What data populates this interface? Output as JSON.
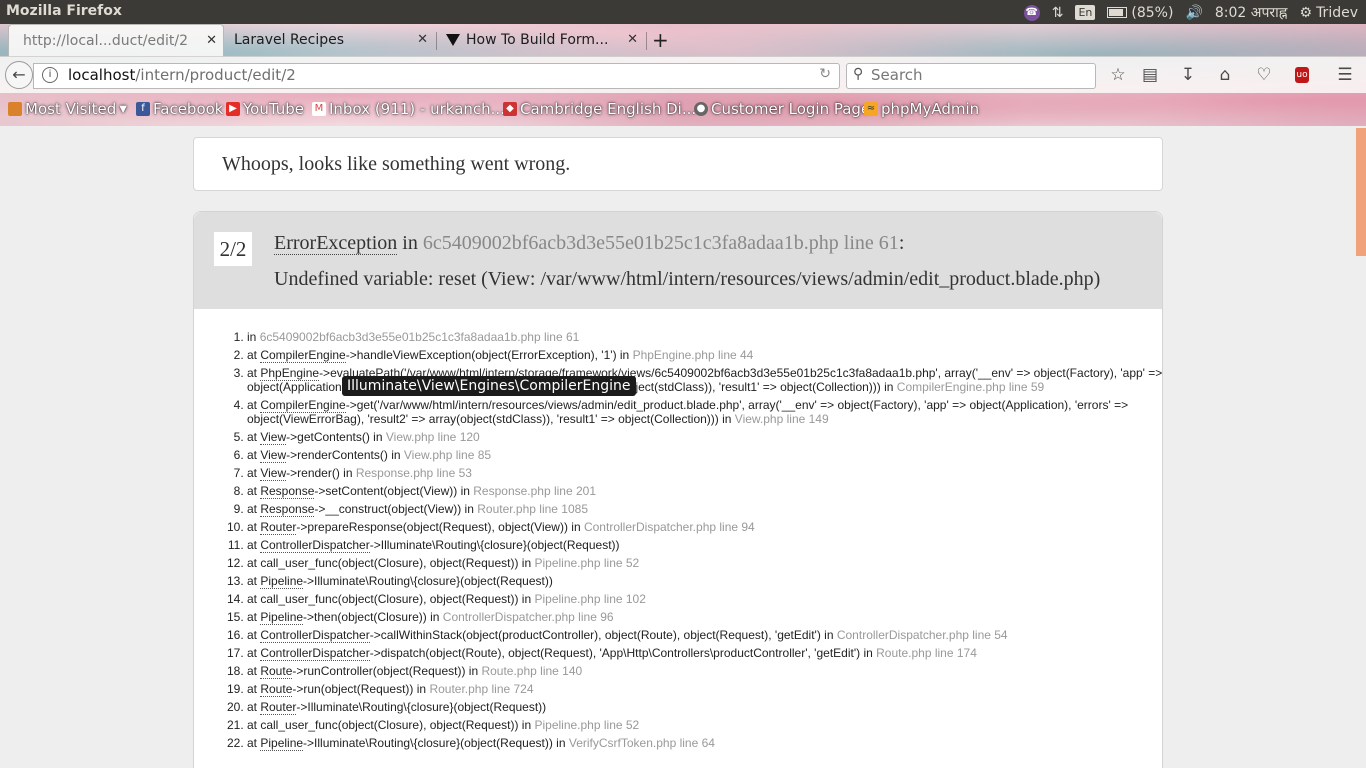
{
  "system": {
    "app_name": "Mozilla Firefox",
    "keyboard": "En",
    "battery": "(85%)",
    "time": "8:02 अपराह्न",
    "user": "Tridev"
  },
  "tabs": [
    {
      "label": "http://local...duct/edit/2"
    },
    {
      "label": "Laravel Recipes"
    },
    {
      "label": "How To Build Form..."
    }
  ],
  "navbar": {
    "url_host": "localhost",
    "url_path": "/intern/product/edit/2",
    "search_placeholder": "Search"
  },
  "bookmarks": [
    {
      "label": "Most Visited"
    },
    {
      "label": "Facebook"
    },
    {
      "label": "YouTube"
    },
    {
      "label": "Inbox (911) - urkanch..."
    },
    {
      "label": "Cambridge English Di..."
    },
    {
      "label": "Customer Login Page"
    },
    {
      "label": "phpMyAdmin"
    }
  ],
  "page": {
    "whoops": "Whoops, looks like something went wrong.",
    "counter": "2/2",
    "exception": "ErrorException",
    "in_word": "in",
    "file_line": "6c5409002bf6acb3d3e55e01b25c1c3fa8adaa1b.php line 61",
    "colon": ":",
    "message": "Undefined variable: reset (View: /var/www/html/intern/resources/views/admin/edit_product.blade.php)",
    "tooltip": "Illuminate\\View\\Engines\\CompilerEngine"
  },
  "trace": [
    {
      "pre": "in ",
      "cls": "",
      "rest": "",
      "loc": "6c5409002bf6acb3d3e55e01b25c1c3fa8adaa1b.php line 61"
    },
    {
      "pre": "at ",
      "cls": "CompilerEngine",
      "rest": "->handleViewException(object(ErrorException), '1') in ",
      "loc": "PhpEngine.php line 44"
    },
    {
      "pre": "at ",
      "cls": "PhpEngine",
      "rest": "->evaluatePath('/var/www/html/intern/storage/framework/views/6c5409002bf6acb3d3e55e01b25c1c3fa8adaa1b.php', array('__env' => object(Factory), 'app' => object(Application), 'errors' => object(ViewErrorBag), 'result2' => array(object(stdClass)), 'result1' => object(Collection))) in ",
      "loc": "CompilerEngine.php line 59"
    },
    {
      "pre": "at ",
      "cls": "CompilerEngine",
      "rest": "->get('/var/www/html/intern/resources/views/admin/edit_product.blade.php', array('__env' => object(Factory), 'app' => object(Application), 'errors' => object(ViewErrorBag), 'result2' => array(object(stdClass)), 'result1' => object(Collection))) in ",
      "loc": "View.php line 149"
    },
    {
      "pre": "at ",
      "cls": "View",
      "rest": "->getContents() in ",
      "loc": "View.php line 120"
    },
    {
      "pre": "at ",
      "cls": "View",
      "rest": "->renderContents() in ",
      "loc": "View.php line 85"
    },
    {
      "pre": "at ",
      "cls": "View",
      "rest": "->render() in ",
      "loc": "Response.php line 53"
    },
    {
      "pre": "at ",
      "cls": "Response",
      "rest": "->setContent(object(View)) in ",
      "loc": "Response.php line 201"
    },
    {
      "pre": "at ",
      "cls": "Response",
      "rest": "->__construct(object(View)) in ",
      "loc": "Router.php line 1085"
    },
    {
      "pre": "at ",
      "cls": "Router",
      "rest": "->prepareResponse(object(Request), object(View)) in ",
      "loc": "ControllerDispatcher.php line 94"
    },
    {
      "pre": "at ",
      "cls": "ControllerDispatcher",
      "rest": "->Illuminate\\Routing\\{closure}(object(Request))",
      "loc": ""
    },
    {
      "pre": "at call_user_func(object(Closure), object(Request)) in ",
      "cls": "",
      "rest": "",
      "loc": "Pipeline.php line 52"
    },
    {
      "pre": "at ",
      "cls": "Pipeline",
      "rest": "->Illuminate\\Routing\\{closure}(object(Request))",
      "loc": ""
    },
    {
      "pre": "at call_user_func(object(Closure), object(Request)) in ",
      "cls": "",
      "rest": "",
      "loc": "Pipeline.php line 102"
    },
    {
      "pre": "at ",
      "cls": "Pipeline",
      "rest": "->then(object(Closure)) in ",
      "loc": "ControllerDispatcher.php line 96"
    },
    {
      "pre": "at ",
      "cls": "ControllerDispatcher",
      "rest": "->callWithinStack(object(productController), object(Route), object(Request), 'getEdit') in ",
      "loc": "ControllerDispatcher.php line 54"
    },
    {
      "pre": "at ",
      "cls": "ControllerDispatcher",
      "rest": "->dispatch(object(Route), object(Request), 'App\\Http\\Controllers\\productController', 'getEdit') in ",
      "loc": "Route.php line 174"
    },
    {
      "pre": "at ",
      "cls": "Route",
      "rest": "->runController(object(Request)) in ",
      "loc": "Route.php line 140"
    },
    {
      "pre": "at ",
      "cls": "Route",
      "rest": "->run(object(Request)) in ",
      "loc": "Router.php line 724"
    },
    {
      "pre": "at ",
      "cls": "Router",
      "rest": "->Illuminate\\Routing\\{closure}(object(Request))",
      "loc": ""
    },
    {
      "pre": "at call_user_func(object(Closure), object(Request)) in ",
      "cls": "",
      "rest": "",
      "loc": "Pipeline.php line 52"
    },
    {
      "pre": "at ",
      "cls": "Pipeline",
      "rest": "->Illuminate\\Routing\\{closure}(object(Request)) in ",
      "loc": "VerifyCsrfToken.php line 64"
    }
  ]
}
